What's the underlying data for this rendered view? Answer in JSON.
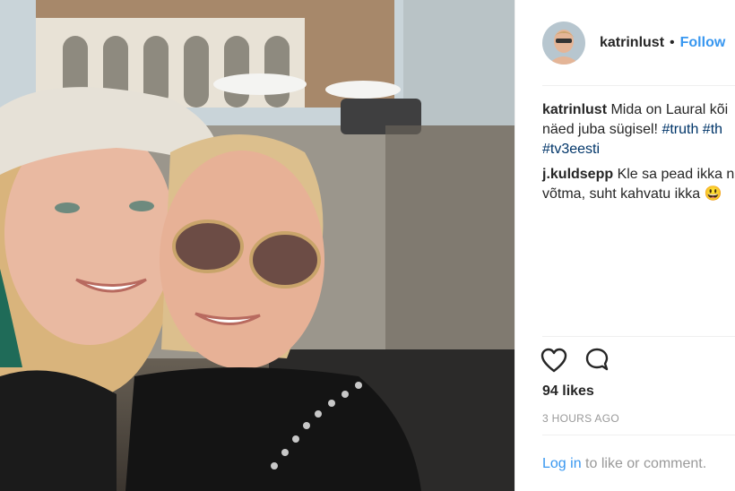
{
  "post": {
    "username": "katrinlust",
    "follow_label": "Follow",
    "separator": "•",
    "caption": {
      "author": "katrinlust",
      "line1": "Mida on Laural kõi",
      "line2_text": "näed juba sügisel! ",
      "tag1": "#truth",
      "tag2": " #th",
      "tag3": "#tv3eesti"
    },
    "comment2": {
      "author": "j.kuldsepp",
      "line1": "Kle sa pead ikka n",
      "line2": "võtma, suht kahvatu ikka",
      "emoji": "😃"
    },
    "likes": "94 likes",
    "timestamp": "3 HOURS AGO",
    "login_link": "Log in",
    "login_text": " to like or comment."
  },
  "colors": {
    "link": "#3897f0",
    "hashtag": "#003569",
    "muted": "#999999"
  },
  "icons": {
    "like": "heart-icon",
    "comment": "comment-icon"
  }
}
